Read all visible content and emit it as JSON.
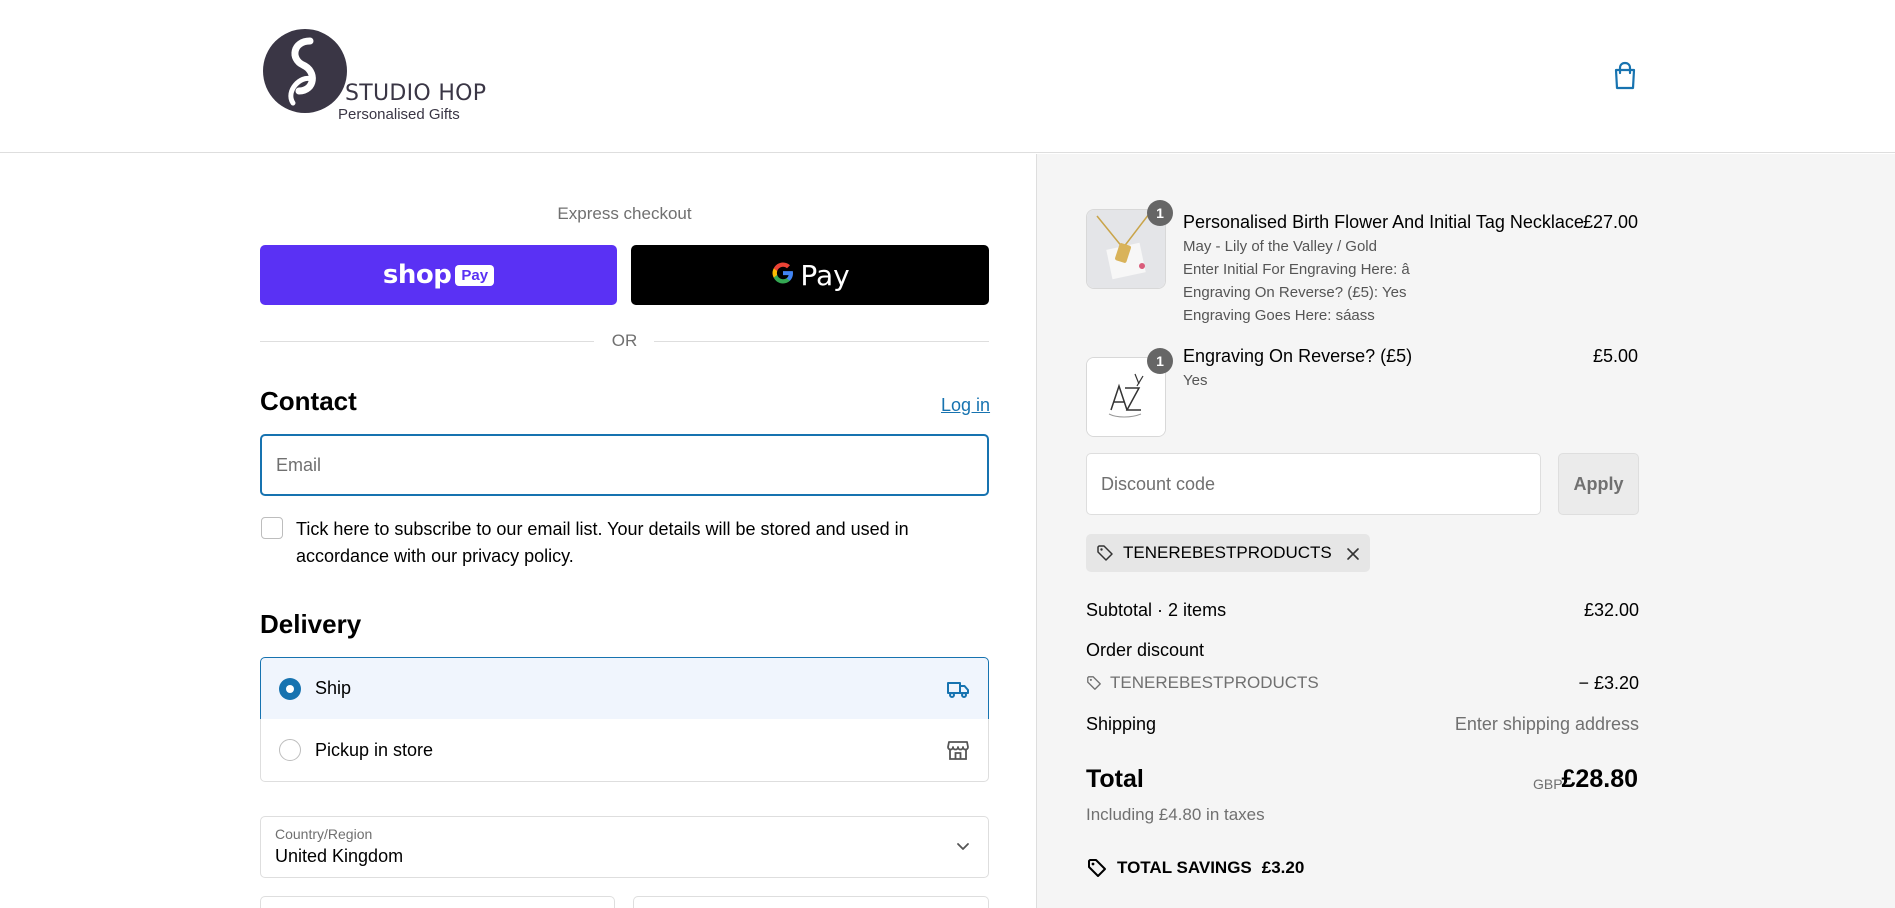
{
  "header": {
    "logo_name": "STUDIO HOP",
    "logo_subtitle": "Personalised Gifts"
  },
  "express": {
    "label": "Express checkout",
    "shop_pay_word": "shop",
    "shop_pay_pill": "Pay",
    "gpay_word": "Pay",
    "divider_text": "OR"
  },
  "contact": {
    "heading": "Contact",
    "login_label": "Log in",
    "email_placeholder": "Email",
    "email_value": "",
    "subscribe_text": "Tick here to subscribe to our email list. Your details will be stored and used in accordance with our privacy policy.",
    "subscribe_checked": false
  },
  "delivery": {
    "heading": "Delivery",
    "options": [
      {
        "label": "Ship",
        "selected": true,
        "icon": "truck-icon"
      },
      {
        "label": "Pickup in store",
        "selected": false,
        "icon": "store-icon"
      }
    ],
    "country_label": "Country/Region",
    "country_value": "United Kingdom"
  },
  "order": {
    "items": [
      {
        "title": "Personalised Birth Flower And Initial Tag Necklace",
        "price": "£27.00",
        "quantity": "1",
        "meta": [
          "May - Lily of the Valley / Gold",
          "Enter Initial For Engraving Here: â",
          "Engraving On Reverse? (£5): Yes",
          "Engraving Goes Here: sáass"
        ]
      },
      {
        "title": "Engraving On Reverse? (£5)",
        "price": "£5.00",
        "quantity": "1",
        "meta": [
          "Yes"
        ]
      }
    ],
    "discount_placeholder": "Discount code",
    "apply_label": "Apply",
    "applied_code": "TENEREBESTPRODUCTS",
    "subtotal_label": "Subtotal · 2 items",
    "subtotal_value": "£32.00",
    "order_discount_label": "Order discount",
    "order_discount_code": "TENEREBESTPRODUCTS",
    "order_discount_value": "− £3.20",
    "shipping_label": "Shipping",
    "shipping_value": "Enter shipping address",
    "total_label": "Total",
    "total_currency": "GBP",
    "total_value": "£28.80",
    "taxes_text": "Including £4.80 in taxes",
    "savings_label": "TOTAL SAVINGS",
    "savings_value": "£3.20"
  },
  "colors": {
    "accent": "#1773b0",
    "shop_pay": "#5a31f4",
    "summary_bg": "#f5f5f5",
    "selected_bg": "#f0f5fd"
  }
}
